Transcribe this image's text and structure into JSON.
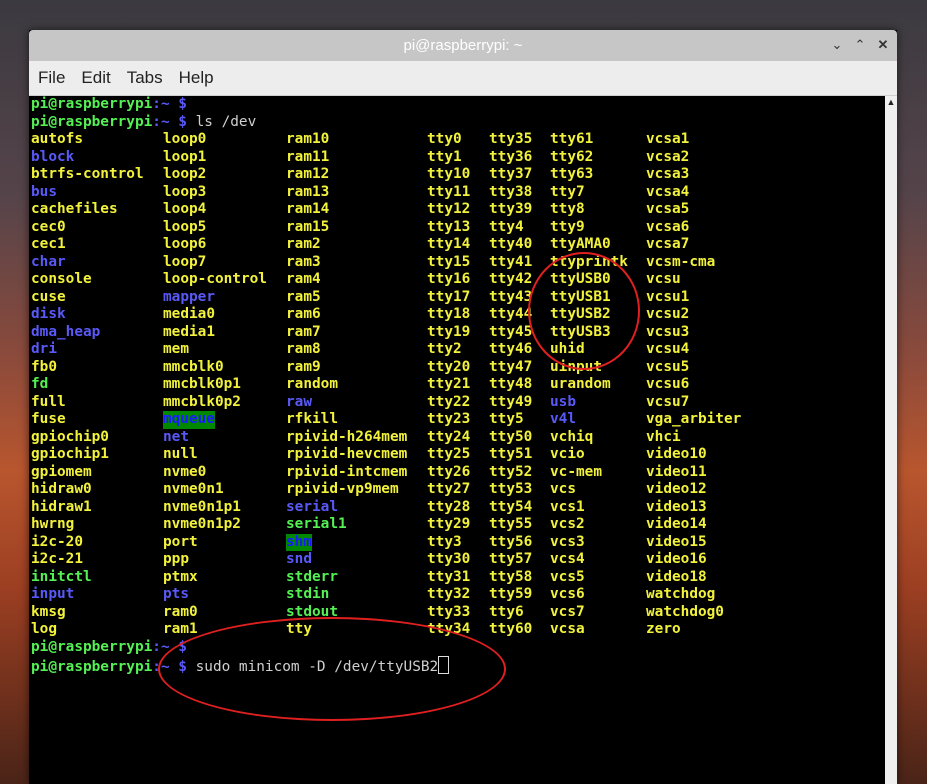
{
  "window": {
    "title": "pi@raspberrypi: ~"
  },
  "menu": [
    "File",
    "Edit",
    "Tabs",
    "Help"
  ],
  "prompt": {
    "user": "pi@raspberrypi",
    "path": ":~ $"
  },
  "lines": [
    {
      "cmd": ""
    },
    {
      "cmd": " ls /dev"
    }
  ],
  "last_command": " sudo minicom -D /dev/ttyUSB2",
  "columns_x": [
    0,
    132,
    255,
    396,
    458,
    519,
    615
  ],
  "rows": [
    [
      [
        "autofs",
        "y"
      ],
      [
        "loop0",
        "y"
      ],
      [
        "ram10",
        "y"
      ],
      [
        "tty0",
        "y"
      ],
      [
        "tty35",
        "y"
      ],
      [
        "tty61",
        "y"
      ],
      [
        "vcsa1",
        "y"
      ]
    ],
    [
      [
        "block",
        "b"
      ],
      [
        "loop1",
        "y"
      ],
      [
        "ram11",
        "y"
      ],
      [
        "tty1",
        "y"
      ],
      [
        "tty36",
        "y"
      ],
      [
        "tty62",
        "y"
      ],
      [
        "vcsa2",
        "y"
      ]
    ],
    [
      [
        "btrfs-control",
        "y"
      ],
      [
        "loop2",
        "y"
      ],
      [
        "ram12",
        "y"
      ],
      [
        "tty10",
        "y"
      ],
      [
        "tty37",
        "y"
      ],
      [
        "tty63",
        "y"
      ],
      [
        "vcsa3",
        "y"
      ]
    ],
    [
      [
        "bus",
        "b"
      ],
      [
        "loop3",
        "y"
      ],
      [
        "ram13",
        "y"
      ],
      [
        "tty11",
        "y"
      ],
      [
        "tty38",
        "y"
      ],
      [
        "tty7",
        "y"
      ],
      [
        "vcsa4",
        "y"
      ]
    ],
    [
      [
        "cachefiles",
        "y"
      ],
      [
        "loop4",
        "y"
      ],
      [
        "ram14",
        "y"
      ],
      [
        "tty12",
        "y"
      ],
      [
        "tty39",
        "y"
      ],
      [
        "tty8",
        "y"
      ],
      [
        "vcsa5",
        "y"
      ]
    ],
    [
      [
        "cec0",
        "y"
      ],
      [
        "loop5",
        "y"
      ],
      [
        "ram15",
        "y"
      ],
      [
        "tty13",
        "y"
      ],
      [
        "tty4",
        "y"
      ],
      [
        "tty9",
        "y"
      ],
      [
        "vcsa6",
        "y"
      ]
    ],
    [
      [
        "cec1",
        "y"
      ],
      [
        "loop6",
        "y"
      ],
      [
        "ram2",
        "y"
      ],
      [
        "tty14",
        "y"
      ],
      [
        "tty40",
        "y"
      ],
      [
        "ttyAMA0",
        "y"
      ],
      [
        "vcsa7",
        "y"
      ]
    ],
    [
      [
        "char",
        "b"
      ],
      [
        "loop7",
        "y"
      ],
      [
        "ram3",
        "y"
      ],
      [
        "tty15",
        "y"
      ],
      [
        "tty41",
        "y"
      ],
      [
        "ttyprintk",
        "y"
      ],
      [
        "vcsm-cma",
        "y"
      ]
    ],
    [
      [
        "console",
        "y"
      ],
      [
        "loop-control",
        "y"
      ],
      [
        "ram4",
        "y"
      ],
      [
        "tty16",
        "y"
      ],
      [
        "tty42",
        "y"
      ],
      [
        "ttyUSB0",
        "y"
      ],
      [
        "vcsu",
        "y"
      ]
    ],
    [
      [
        "cuse",
        "y"
      ],
      [
        "mapper",
        "b"
      ],
      [
        "ram5",
        "y"
      ],
      [
        "tty17",
        "y"
      ],
      [
        "tty43",
        "y"
      ],
      [
        "ttyUSB1",
        "y"
      ],
      [
        "vcsu1",
        "y"
      ]
    ],
    [
      [
        "disk",
        "b"
      ],
      [
        "media0",
        "y"
      ],
      [
        "ram6",
        "y"
      ],
      [
        "tty18",
        "y"
      ],
      [
        "tty44",
        "y"
      ],
      [
        "ttyUSB2",
        "y"
      ],
      [
        "vcsu2",
        "y"
      ]
    ],
    [
      [
        "dma_heap",
        "b"
      ],
      [
        "media1",
        "y"
      ],
      [
        "ram7",
        "y"
      ],
      [
        "tty19",
        "y"
      ],
      [
        "tty45",
        "y"
      ],
      [
        "ttyUSB3",
        "y"
      ],
      [
        "vcsu3",
        "y"
      ]
    ],
    [
      [
        "dri",
        "b"
      ],
      [
        "mem",
        "y"
      ],
      [
        "ram8",
        "y"
      ],
      [
        "tty2",
        "y"
      ],
      [
        "tty46",
        "y"
      ],
      [
        "uhid",
        "y"
      ],
      [
        "vcsu4",
        "y"
      ]
    ],
    [
      [
        "fb0",
        "y"
      ],
      [
        "mmcblk0",
        "y"
      ],
      [
        "ram9",
        "y"
      ],
      [
        "tty20",
        "y"
      ],
      [
        "tty47",
        "y"
      ],
      [
        "uinput",
        "y"
      ],
      [
        "vcsu5",
        "y"
      ]
    ],
    [
      [
        "fd",
        "g"
      ],
      [
        "mmcblk0p1",
        "y"
      ],
      [
        "random",
        "y"
      ],
      [
        "tty21",
        "y"
      ],
      [
        "tty48",
        "y"
      ],
      [
        "urandom",
        "y"
      ],
      [
        "vcsu6",
        "y"
      ]
    ],
    [
      [
        "full",
        "y"
      ],
      [
        "mmcblk0p2",
        "y"
      ],
      [
        "raw",
        "b"
      ],
      [
        "tty22",
        "y"
      ],
      [
        "tty49",
        "y"
      ],
      [
        "usb",
        "b"
      ],
      [
        "vcsu7",
        "y"
      ]
    ],
    [
      [
        "fuse",
        "y"
      ],
      [
        "mqueue",
        "hl"
      ],
      [
        "rfkill",
        "y"
      ],
      [
        "tty23",
        "y"
      ],
      [
        "tty5",
        "y"
      ],
      [
        "v4l",
        "b"
      ],
      [
        "vga_arbiter",
        "y"
      ]
    ],
    [
      [
        "gpiochip0",
        "y"
      ],
      [
        "net",
        "b"
      ],
      [
        "rpivid-h264mem",
        "y"
      ],
      [
        "tty24",
        "y"
      ],
      [
        "tty50",
        "y"
      ],
      [
        "vchiq",
        "y"
      ],
      [
        "vhci",
        "y"
      ]
    ],
    [
      [
        "gpiochip1",
        "y"
      ],
      [
        "null",
        "y"
      ],
      [
        "rpivid-hevcmem",
        "y"
      ],
      [
        "tty25",
        "y"
      ],
      [
        "tty51",
        "y"
      ],
      [
        "vcio",
        "y"
      ],
      [
        "video10",
        "y"
      ]
    ],
    [
      [
        "gpiomem",
        "y"
      ],
      [
        "nvme0",
        "y"
      ],
      [
        "rpivid-intcmem",
        "y"
      ],
      [
        "tty26",
        "y"
      ],
      [
        "tty52",
        "y"
      ],
      [
        "vc-mem",
        "y"
      ],
      [
        "video11",
        "y"
      ]
    ],
    [
      [
        "hidraw0",
        "y"
      ],
      [
        "nvme0n1",
        "y"
      ],
      [
        "rpivid-vp9mem",
        "y"
      ],
      [
        "tty27",
        "y"
      ],
      [
        "tty53",
        "y"
      ],
      [
        "vcs",
        "y"
      ],
      [
        "video12",
        "y"
      ]
    ],
    [
      [
        "hidraw1",
        "y"
      ],
      [
        "nvme0n1p1",
        "y"
      ],
      [
        "serial",
        "b"
      ],
      [
        "tty28",
        "y"
      ],
      [
        "tty54",
        "y"
      ],
      [
        "vcs1",
        "y"
      ],
      [
        "video13",
        "y"
      ]
    ],
    [
      [
        "hwrng",
        "y"
      ],
      [
        "nvme0n1p2",
        "y"
      ],
      [
        "serial1",
        "g"
      ],
      [
        "tty29",
        "y"
      ],
      [
        "tty55",
        "y"
      ],
      [
        "vcs2",
        "y"
      ],
      [
        "video14",
        "y"
      ]
    ],
    [
      [
        "i2c-20",
        "y"
      ],
      [
        "port",
        "y"
      ],
      [
        "shm",
        "hl"
      ],
      [
        "tty3",
        "y"
      ],
      [
        "tty56",
        "y"
      ],
      [
        "vcs3",
        "y"
      ],
      [
        "video15",
        "y"
      ]
    ],
    [
      [
        "i2c-21",
        "y"
      ],
      [
        "ppp",
        "y"
      ],
      [
        "snd",
        "b"
      ],
      [
        "tty30",
        "y"
      ],
      [
        "tty57",
        "y"
      ],
      [
        "vcs4",
        "y"
      ],
      [
        "video16",
        "y"
      ]
    ],
    [
      [
        "initctl",
        "g"
      ],
      [
        "ptmx",
        "y"
      ],
      [
        "stderr",
        "g"
      ],
      [
        "tty31",
        "y"
      ],
      [
        "tty58",
        "y"
      ],
      [
        "vcs5",
        "y"
      ],
      [
        "video18",
        "y"
      ]
    ],
    [
      [
        "input",
        "b"
      ],
      [
        "pts",
        "b"
      ],
      [
        "stdin",
        "g"
      ],
      [
        "tty32",
        "y"
      ],
      [
        "tty59",
        "y"
      ],
      [
        "vcs6",
        "y"
      ],
      [
        "watchdog",
        "y"
      ]
    ],
    [
      [
        "kmsg",
        "y"
      ],
      [
        "ram0",
        "y"
      ],
      [
        "stdout",
        "g"
      ],
      [
        "tty33",
        "y"
      ],
      [
        "tty6",
        "y"
      ],
      [
        "vcs7",
        "y"
      ],
      [
        "watchdog0",
        "y"
      ]
    ],
    [
      [
        "log",
        "y"
      ],
      [
        "ram1",
        "y"
      ],
      [
        "tty",
        "y"
      ],
      [
        "tty34",
        "y"
      ],
      [
        "tty60",
        "y"
      ],
      [
        "vcsa",
        "y"
      ],
      [
        "zero",
        "y"
      ]
    ]
  ],
  "colors": {
    "dir": "#5959f7",
    "device": "#f2f23c",
    "link": "#54f054",
    "annotation": "#e02020"
  }
}
